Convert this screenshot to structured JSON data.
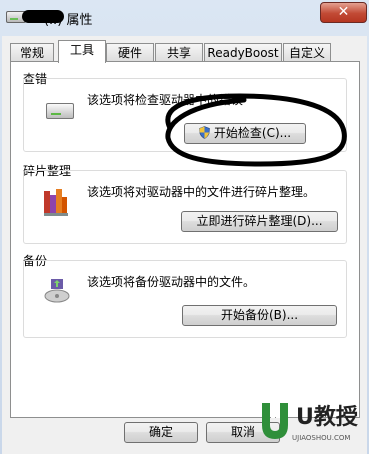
{
  "window": {
    "title_suffix": "(I:) 属性",
    "close_glyph": "✕"
  },
  "tabs": [
    {
      "label": "常规",
      "active": false
    },
    {
      "label": "工具",
      "active": true
    },
    {
      "label": "硬件",
      "active": false
    },
    {
      "label": "共享",
      "active": false
    },
    {
      "label": "ReadyBoost",
      "active": false
    },
    {
      "label": "自定义",
      "active": false
    }
  ],
  "error_check": {
    "heading": "查错",
    "description": "该选项将检查驱动器中的错误",
    "button_label": "开始检查(C)..."
  },
  "defrag": {
    "heading": "碎片整理",
    "description": "该选项将对驱动器中的文件进行碎片整理。",
    "button_label": "立即进行碎片整理(D)..."
  },
  "backup": {
    "heading": "备份",
    "description": "该选项将备份驱动器中的文件。",
    "button_label": "开始备份(B)..."
  },
  "footer": {
    "ok_label": "确定",
    "cancel_label": "取消"
  },
  "watermark": {
    "brand": "U教授",
    "url": "UJIAOSHOU.COM"
  },
  "colors": {
    "close_button": "#c24a35",
    "annotation": "#000000",
    "watermark_green": "#2f8f3a"
  }
}
